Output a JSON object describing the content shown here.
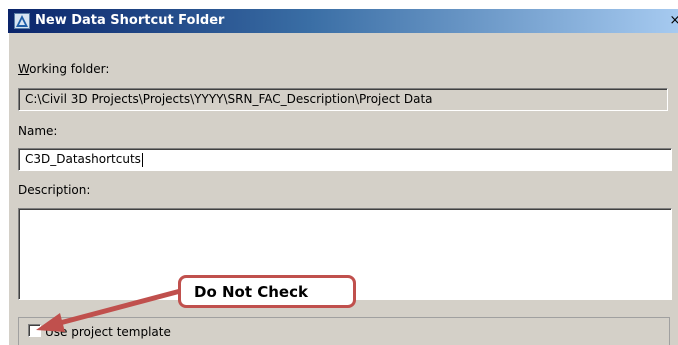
{
  "window": {
    "title": "New Data Shortcut Folder",
    "close_symbol": "×",
    "app_icon": "autodesk-a-icon"
  },
  "form": {
    "working_folder_label_u": "W",
    "working_folder_label_rest": "orking folder:",
    "working_folder_value": "C:\\Civil 3D Projects\\Projects\\YYYY\\SRN_FAC_Description\\Project Data",
    "name_label": "Name:",
    "name_value": "C3D_Datashortcuts",
    "description_label": "Description:",
    "description_value": "",
    "use_template_label": "Use project template",
    "use_template_checked": false
  },
  "annotation": {
    "callout_text": "Do Not Check",
    "callout_color": "#c0504d"
  }
}
